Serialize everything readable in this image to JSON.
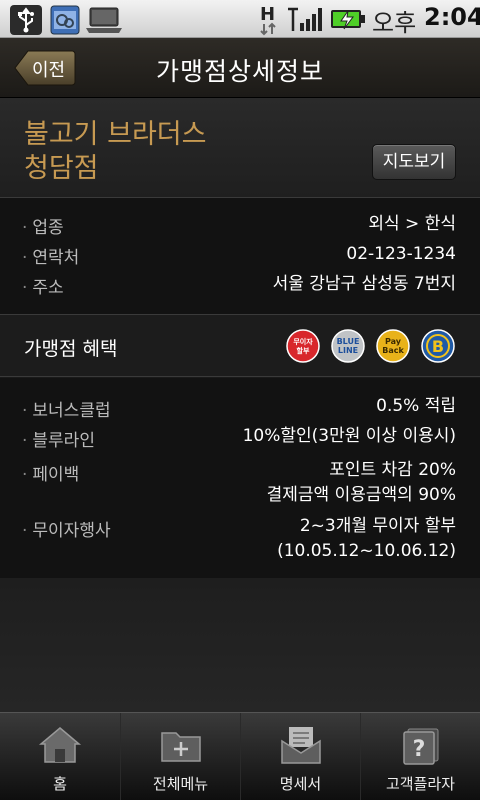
{
  "status_bar": {
    "ampm": "오후",
    "time": "2:04",
    "network_type": "H",
    "icons": [
      "usb-icon",
      "notification-icon",
      "laptop-icon",
      "network-h-icon",
      "signal-icon",
      "battery-charging-icon"
    ]
  },
  "header": {
    "back_label": "이전",
    "title": "가맹점상세정보"
  },
  "store": {
    "name_line1": "불고기 브라더스",
    "name_line2": "청담점",
    "map_button": "지도보기"
  },
  "basic_info": [
    {
      "label": "업종",
      "value": "외식 > 한식"
    },
    {
      "label": "연락처",
      "value": "02-123-1234"
    },
    {
      "label": "주소",
      "value": "서울 강남구 삼성동 7번지"
    }
  ],
  "benefits": {
    "title": "가맹점 혜택",
    "badges": [
      {
        "icon": "interest-free-badge",
        "text1": "무이자",
        "text2": "할부",
        "color": "#d8272c"
      },
      {
        "icon": "blue-line-badge",
        "text1": "BLUE",
        "text2": "LINE",
        "color": "#c0c3c6"
      },
      {
        "icon": "payback-badge",
        "text1": "Pay",
        "text2": "Back",
        "color": "#e8b21a"
      },
      {
        "icon": "b-badge",
        "text1": "B",
        "text2": "",
        "color": "#1f5aa6"
      }
    ]
  },
  "details": [
    {
      "label": "보너스클럽",
      "value_line1": "0.5% 적립",
      "value_line2": ""
    },
    {
      "label": "블루라인",
      "value_line1": "10%할인(3만원 이상 이용시)",
      "value_line2": ""
    },
    {
      "label": "페이백",
      "value_line1": "포인트 차감 20%",
      "value_line2": "결제금액 이용금액의 90%"
    },
    {
      "label": "무이자행사",
      "value_line1": "2~3개월 무이자 할부",
      "value_line2": "(10.05.12~10.06.12)"
    }
  ],
  "tabs": [
    {
      "label": "홈",
      "icon": "home-icon"
    },
    {
      "label": "전체메뉴",
      "icon": "folder-add-icon"
    },
    {
      "label": "명세서",
      "icon": "statement-mail-icon"
    },
    {
      "label": "고객플라자",
      "icon": "help-icon"
    }
  ],
  "colors": {
    "store_name": "#c79a52",
    "background": "#121212"
  }
}
